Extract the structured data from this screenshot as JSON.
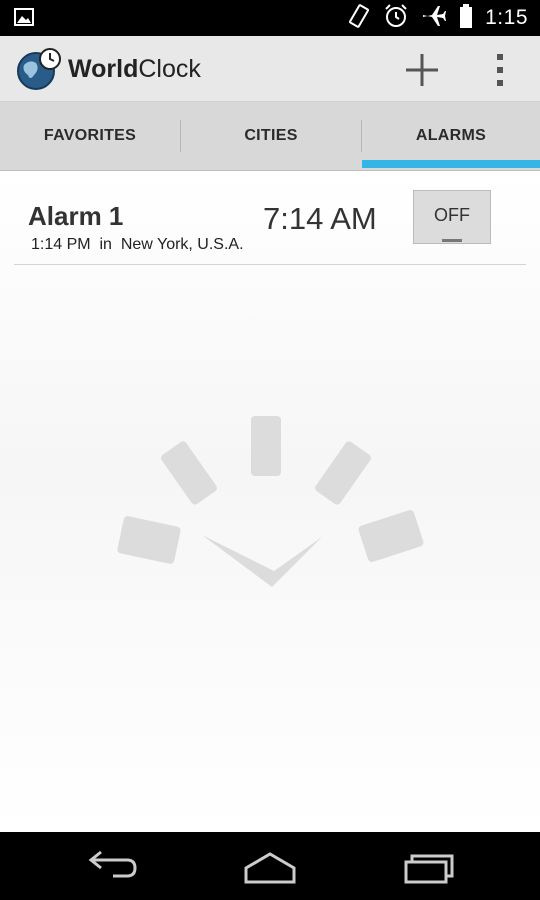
{
  "status_bar": {
    "time": "1:15",
    "icons": [
      "gallery-icon",
      "rotate-icon",
      "alarm-clock-icon",
      "airplane-icon",
      "battery-icon"
    ]
  },
  "app": {
    "title_bold": "World",
    "title_regular": "Clock",
    "icons": [
      "world-clock-logo-icon",
      "add-icon",
      "overflow-menu-icon"
    ]
  },
  "tabs": [
    {
      "label": "FAVORITES",
      "selected": false
    },
    {
      "label": "CITIES",
      "selected": false
    },
    {
      "label": "ALARMS",
      "selected": true
    }
  ],
  "colors": {
    "accent": "#33b5e5"
  },
  "alarms": [
    {
      "name": "Alarm 1",
      "subtitle": "1:14 PM  in  New York, U.S.A.",
      "time": "7:14 AM",
      "toggle_label": "OFF"
    }
  ],
  "nav_bar": {
    "icons": [
      "back-icon",
      "home-icon",
      "recent-apps-icon"
    ]
  }
}
